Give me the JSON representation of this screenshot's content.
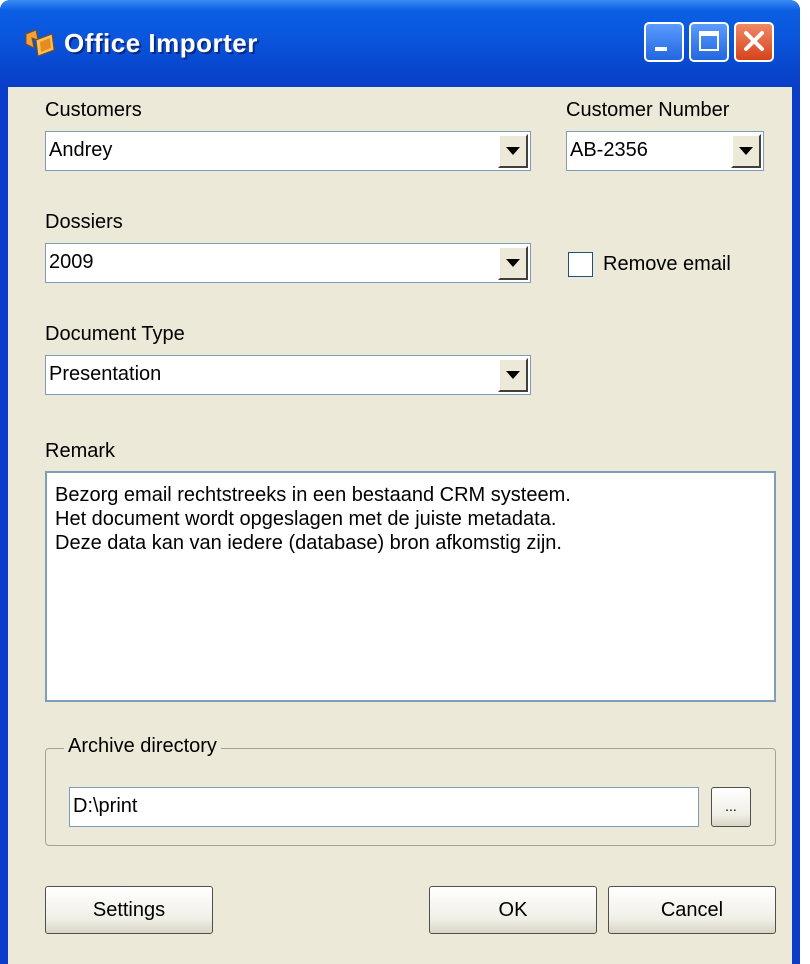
{
  "window": {
    "title": "Office Importer"
  },
  "customers": {
    "label": "Customers",
    "value": "Andrey"
  },
  "customer_number": {
    "label": "Customer Number",
    "value": "AB-2356"
  },
  "dossiers": {
    "label": "Dossiers",
    "value": "2009"
  },
  "remove_email": {
    "label": "Remove email",
    "checked": false
  },
  "document_type": {
    "label": "Document Type",
    "value": "Presentation"
  },
  "remark": {
    "label": "Remark",
    "text": "Bezorg email rechtstreeks in een bestaand CRM systeem.\nHet document wordt opgeslagen met de juiste metadata.\nDeze data kan van iedere (database) bron afkomstig zijn."
  },
  "archive": {
    "group_label": "Archive directory",
    "path": "D:\\print",
    "browse_label": "..."
  },
  "buttons": {
    "settings": "Settings",
    "ok": "OK",
    "cancel": "Cancel"
  },
  "colors": {
    "titlebar": "#0a55dc",
    "client": "#ece9d8",
    "close_button": "#d6421c"
  },
  "icons": [
    "app-icon",
    "minimize-icon",
    "maximize-icon",
    "close-icon",
    "chevron-down-icon"
  ]
}
